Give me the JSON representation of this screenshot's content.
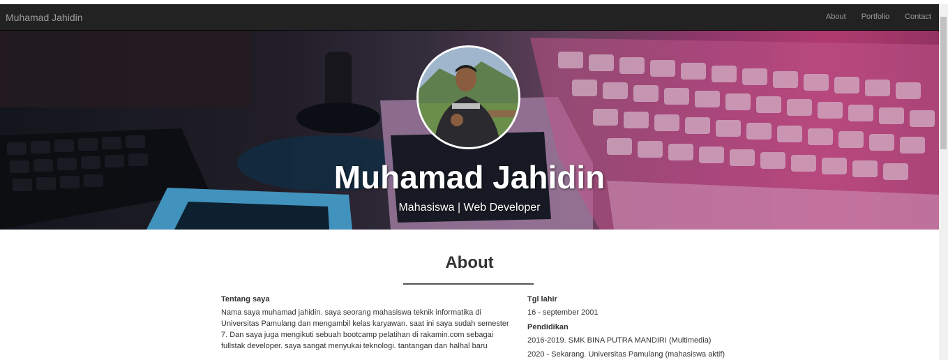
{
  "navbar": {
    "brand": "Muhamad Jahidin",
    "links": [
      "About",
      "Portfolio",
      "Contact"
    ]
  },
  "hero": {
    "name": "Muhamad Jahidin",
    "subtitle": "Mahasiswa | Web Developer"
  },
  "about": {
    "title": "About",
    "left": {
      "heading": "Tentang saya",
      "body": "Nama saya muhamad jahidin. saya seorang mahasiswa teknik informatika di Universitas Pamulang dan mengambil kelas karyawan. saat ini saya sudah semester 7. Dan saya juga mengikuti sebuah bootcamp pelatihan di rakamin.com sebagai fullstak developer. saya sangat menyukai teknologi. tantangan dan halhal baru"
    },
    "right": {
      "birth_heading": "Tgl lahir",
      "birth_value": "16 - september 2001",
      "edu_heading": "Pendidikan",
      "edu_items": [
        "2016-2019. SMK BINA PUTRA MANDIRI (Multimedia)",
        "2020 - Sekarang. Universitas Pamulang (mahasiswa aktif)"
      ]
    }
  },
  "colors": {
    "navbar_bg": "#222222",
    "nav_text": "#9d9d9d",
    "hero_accent": "#c9447f"
  }
}
